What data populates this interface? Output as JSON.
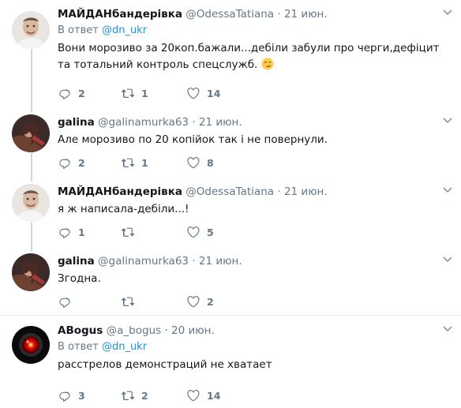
{
  "tweets": [
    {
      "name": "МАЙДАНбандерівка",
      "handle": "@OdessaTatiana",
      "dot": "·",
      "time": "21 июн.",
      "reply_prefix": "В ответ",
      "reply_to": "@dn_ukr",
      "text": "Вони морозиво за 20коп.бажали...дебіли забули про черги,дефіцит та тотальний контроль спецслужб.",
      "emoji": "smirking-face",
      "replies": "2",
      "retweets": "1",
      "likes": "14"
    },
    {
      "name": "galina",
      "handle": "@galinamurka63",
      "dot": "·",
      "time": "21 июн.",
      "text": "Але морозиво по 20 копійок так і не повернули.",
      "replies": "2",
      "retweets": "1",
      "likes": "8"
    },
    {
      "name": "МАЙДАНбандерівка",
      "handle": "@OdessaTatiana",
      "dot": "·",
      "time": "21 июн.",
      "text": "я ж написала-дебіли...!",
      "replies": "1",
      "retweets": "",
      "likes": "5"
    },
    {
      "name": "galina",
      "handle": "@galinamurka63",
      "dot": "·",
      "time": "21 июн.",
      "text": "Згодна.",
      "replies": "",
      "retweets": "",
      "likes": "2"
    },
    {
      "name": "ABogus",
      "handle": "@a_bogus",
      "dot": "·",
      "time": "20 июн.",
      "reply_prefix": "В ответ",
      "reply_to": "@dn_ukr",
      "text": "расстрелов демонстраций не хватает",
      "replies": "3",
      "retweets": "2",
      "likes": "14"
    }
  ],
  "colors": {
    "link": "#1b95e0",
    "muted": "#657786",
    "thread_line": "#ccd6dd",
    "separator": "#e6ecf0"
  },
  "icons": [
    "reply-icon",
    "retweet-icon",
    "like-icon",
    "chevron-down-icon"
  ]
}
